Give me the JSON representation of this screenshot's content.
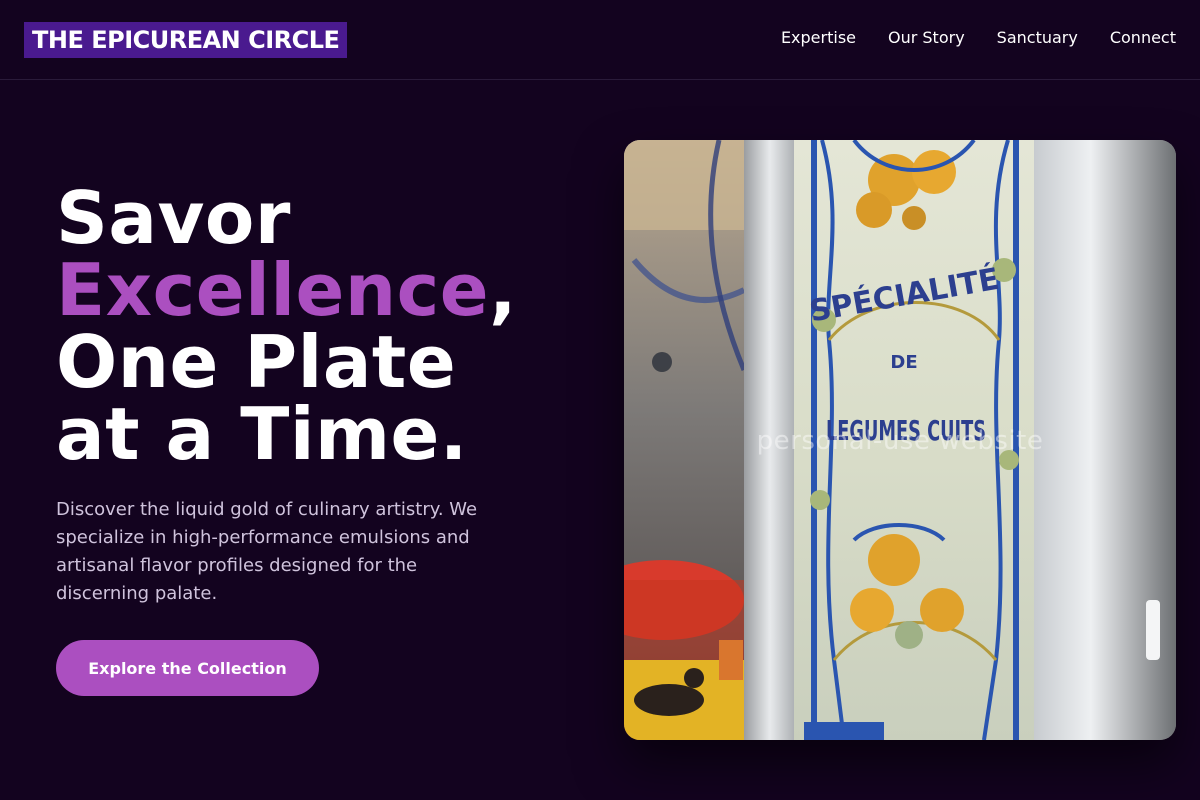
{
  "header": {
    "brand": "THE EPICUREAN CIRCLE",
    "nav": [
      "Expertise",
      "Our Story",
      "Sanctuary",
      "Connect"
    ]
  },
  "hero": {
    "title_line1": "Savor",
    "title_accent": "Excellence",
    "title_comma": ",",
    "title_line3": "One Plate",
    "title_line4": "at a Time.",
    "description": "Discover the liquid gold of culinary artistry. We specialize in high-performance emulsions and artisanal flavor profiles designed for the discerning palate.",
    "cta_label": "Explore the Collection"
  },
  "image": {
    "sign_line1": "SPÉCIALITÉ",
    "sign_line2": "DE",
    "sign_line3": "LEGUMES CUITS",
    "watermark": "personal-use website"
  },
  "colors": {
    "background": "#13031f",
    "brand_bg": "#4a1a8f",
    "accent": "#ab4fc0",
    "text": "#ffffff",
    "muted_text": "#cfc3dc"
  }
}
